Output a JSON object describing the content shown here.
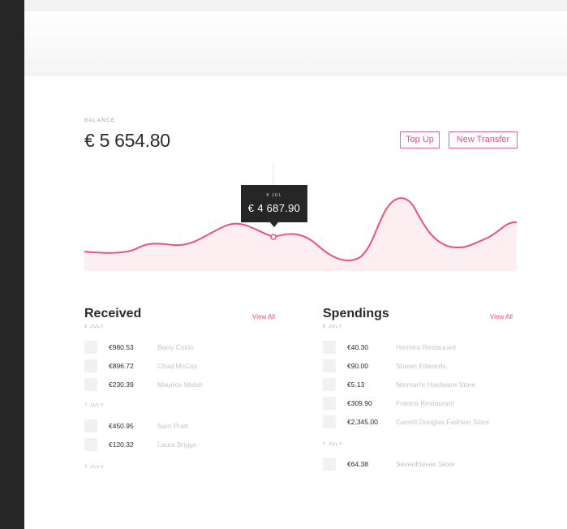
{
  "balance": {
    "label": "BALANCE",
    "value": "€ 5 654.80"
  },
  "actions": {
    "top_up": "Top Up",
    "new_transfer": "New Transfer"
  },
  "chart_tooltip": {
    "date": "8 JUL",
    "value": "€ 4 687.90"
  },
  "colors": {
    "accent": "#ef4f7b",
    "sidebar": "#262626",
    "chart_fill": "#fde9ef"
  },
  "received": {
    "title": "Received",
    "view_all": "View All",
    "groups": [
      {
        "date": "8 JULY",
        "items": [
          {
            "amount": "€980.53",
            "name": "Barry Colon"
          },
          {
            "amount": "€896.72",
            "name": "Chad McCoy"
          },
          {
            "amount": "€230.39",
            "name": "Maurice Walsh"
          }
        ]
      },
      {
        "date": "7 JULY",
        "items": [
          {
            "amount": "€450.95",
            "name": "Sam Pratt"
          },
          {
            "amount": "€120.32",
            "name": "Laura Briggs"
          }
        ]
      },
      {
        "date": "7 JULY",
        "items": []
      }
    ]
  },
  "spendings": {
    "title": "Spendings",
    "view_all": "View All",
    "groups": [
      {
        "date": "8 JULY",
        "items": [
          {
            "amount": "€40.30",
            "name": "Hermira Restaurant"
          },
          {
            "amount": "€90.00",
            "name": "Shawn Edwards"
          },
          {
            "amount": "€5.13",
            "name": "Norman's Hardware Store"
          },
          {
            "amount": "€309.90",
            "name": "Francis Restaurant"
          },
          {
            "amount": "€2,345.00",
            "name": "Garrett Douglas Fashion Store"
          }
        ]
      },
      {
        "date": "7 JULY",
        "items": [
          {
            "amount": "€64.38",
            "name": "SevenEleven Store"
          }
        ]
      }
    ]
  }
}
